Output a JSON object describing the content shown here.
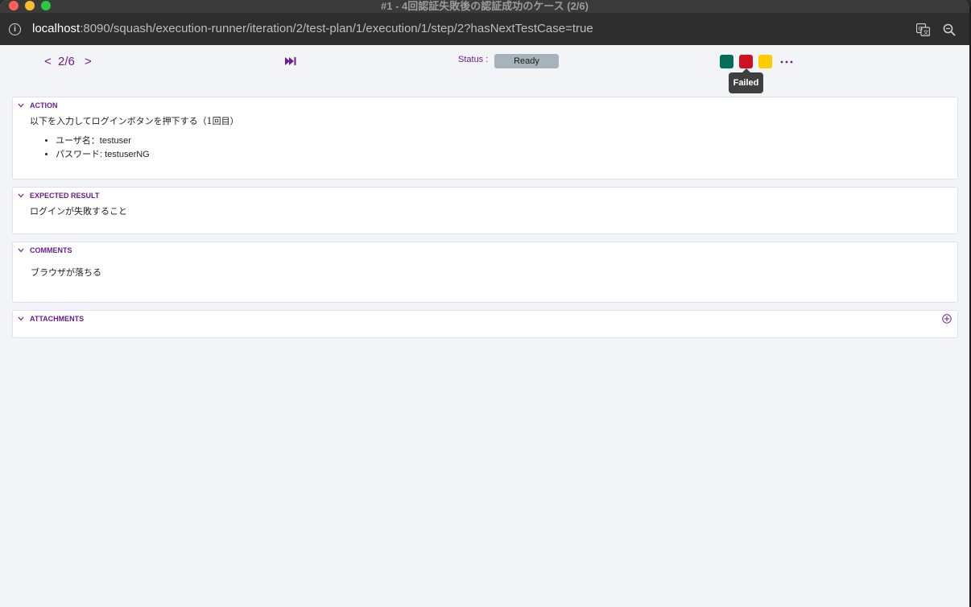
{
  "window": {
    "title": "#1 - 4回認証失敗後の認証成功のケース (2/6)"
  },
  "browser": {
    "url_host": "localhost",
    "url_rest": ":8090/squash/execution-runner/iteration/2/test-plan/1/execution/1/step/2?hasNextTestCase=true"
  },
  "toolbar": {
    "prev": "<",
    "next": ">",
    "step_counter": "2/6",
    "status_label": "Status :",
    "status_value": "Ready",
    "tooltip": "Failed",
    "colors": {
      "success": "#006f57",
      "failed": "#d10f22",
      "blocked": "#ffcc00",
      "accent": "#6b1d8f",
      "ready": "#a6b3bb"
    }
  },
  "action": {
    "title": "ACTION",
    "intro": "以下を入力してログインボタンを押下する（1回目）",
    "items": [
      "ユーザ名：testuser",
      "パスワード: testuserNG"
    ]
  },
  "expected": {
    "title": "EXPECTED RESULT",
    "text": "ログインが失敗すること"
  },
  "comments": {
    "title": "COMMENTS",
    "text": "ブラウザが落ちる"
  },
  "attachments": {
    "title": "ATTACHMENTS"
  }
}
